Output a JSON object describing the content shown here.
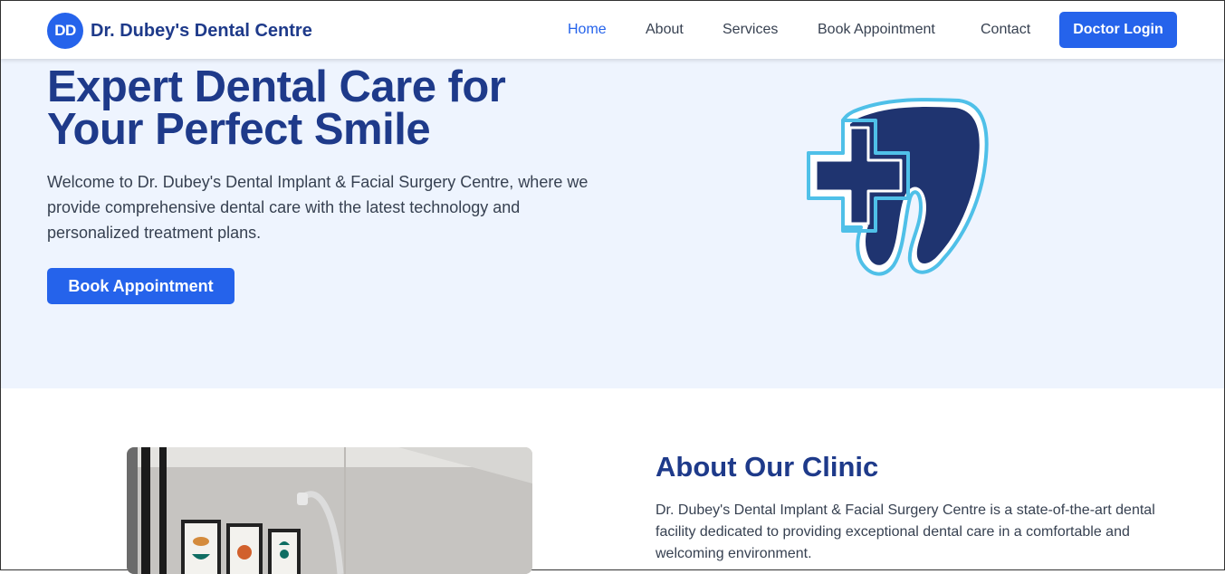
{
  "brand": {
    "badge": "DD",
    "name": "Dr. Dubey's Dental Centre"
  },
  "nav": {
    "links": [
      {
        "label": "Home",
        "active": true
      },
      {
        "label": "About"
      },
      {
        "label": "Services"
      },
      {
        "label": "Book Appointment"
      },
      {
        "label": "Contact"
      }
    ],
    "login_label": "Doctor Login"
  },
  "hero": {
    "title_line1": "Expert Dental Care for",
    "title_line2": "Your Perfect Smile",
    "description": "Welcome to Dr. Dubey's Dental Implant & Facial Surgery Centre, where we provide comprehensive dental care with the latest technology and personalized treatment plans.",
    "cta_label": "Book Appointment"
  },
  "about": {
    "title": "About Our Clinic",
    "description": "Dr. Dubey's Dental Implant & Facial Surgery Centre is a state-of-the-art dental facility dedicated to providing exceptional dental care in a comfortable and welcoming environment."
  },
  "colors": {
    "primary": "#2563eb",
    "heading": "#1e3a8a",
    "hero_bg": "#eef4fe",
    "tooth_fill": "#1f3470",
    "tooth_outline": "#4fc0e8"
  }
}
